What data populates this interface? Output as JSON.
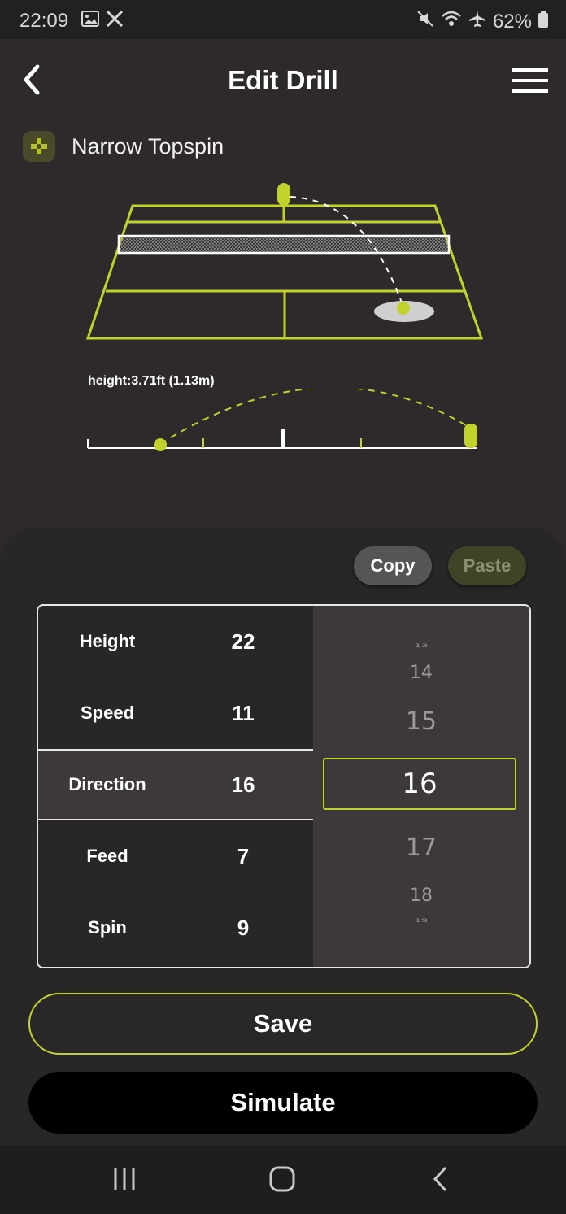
{
  "status": {
    "time": "22:09",
    "battery": "62%"
  },
  "header": {
    "title": "Edit Drill"
  },
  "drill": {
    "name": "Narrow Topspin"
  },
  "trajectory": {
    "height_label": "height:3.71ft (1.13m)"
  },
  "clipboard": {
    "copy_label": "Copy",
    "paste_label": "Paste"
  },
  "params": [
    {
      "label": "Height",
      "value": "22"
    },
    {
      "label": "Speed",
      "value": "11"
    },
    {
      "label": "Direction",
      "value": "16"
    },
    {
      "label": "Feed",
      "value": "7"
    },
    {
      "label": "Spin",
      "value": "9"
    }
  ],
  "picker": {
    "above": [
      "13",
      "14",
      "15"
    ],
    "selected": "16",
    "below": [
      "17",
      "18",
      "19"
    ]
  },
  "actions": {
    "save_label": "Save",
    "simulate_label": "Simulate"
  },
  "colors": {
    "accent": "#c1d22c",
    "background": "#2e2a2b",
    "panel": "#292627"
  }
}
